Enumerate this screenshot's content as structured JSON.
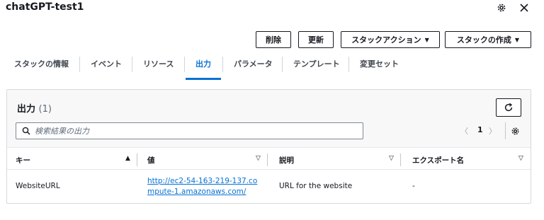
{
  "header": {
    "title": "chatGPT-test1",
    "settings_icon": "gear-icon",
    "close_icon": "close-icon"
  },
  "actions": {
    "delete_label": "削除",
    "update_label": "更新",
    "stack_actions_label": "スタックアクション",
    "create_stack_label": "スタックの作成"
  },
  "tabs": [
    {
      "label": "スタックの情報"
    },
    {
      "label": "イベント"
    },
    {
      "label": "リソース"
    },
    {
      "label": "出力",
      "active": true
    },
    {
      "label": "パラメータ"
    },
    {
      "label": "テンプレート"
    },
    {
      "label": "変更セット"
    }
  ],
  "outputs": {
    "title": "出力",
    "count": "(1)",
    "search_placeholder": "検索結果の出力",
    "page": "1",
    "columns": {
      "key": "キー",
      "value": "値",
      "description": "説明",
      "export_name": "エクスポート名"
    },
    "rows": [
      {
        "key": "WebsiteURL",
        "value": "http://ec2-54-163-219-137.compute-1.amazonaws.com/",
        "description": "URL for the website",
        "export_name": "-"
      }
    ]
  },
  "colors": {
    "accent": "#0972d3",
    "text": "#16191f",
    "muted": "#5f6b7a",
    "border": "#d5dbdb"
  }
}
